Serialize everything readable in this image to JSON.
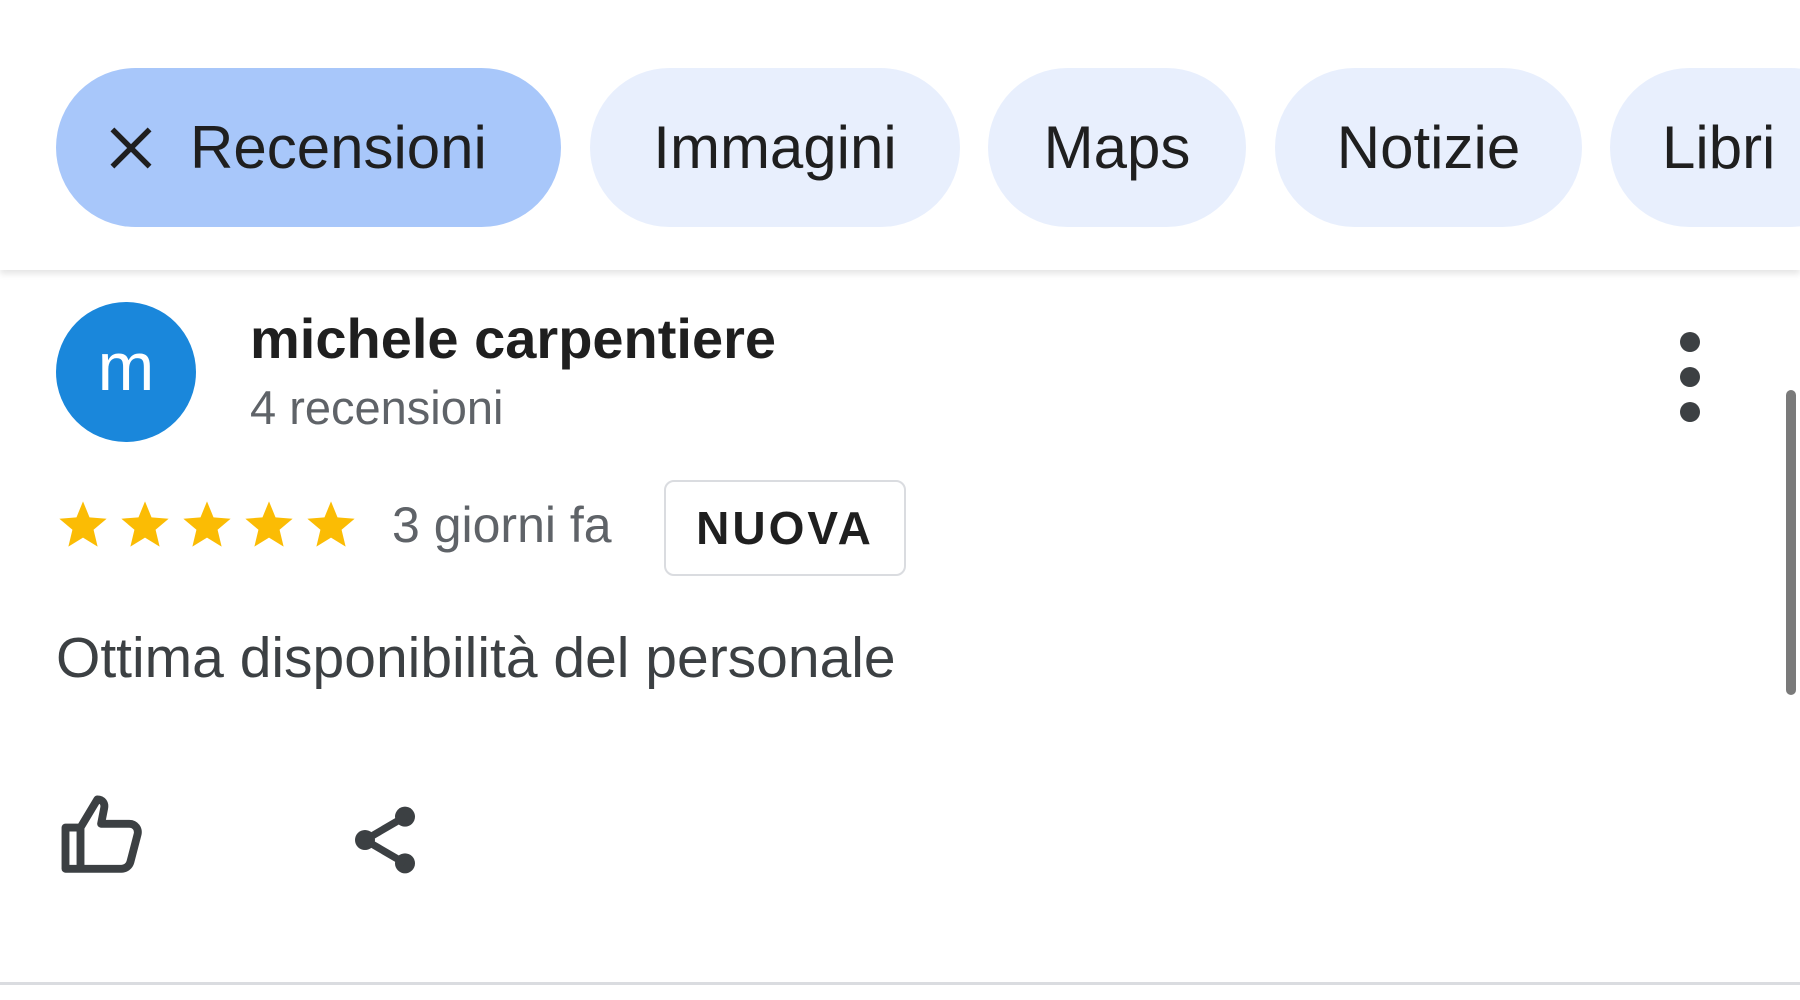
{
  "filters": {
    "chips": [
      {
        "label": "Recensioni",
        "active": true
      },
      {
        "label": "Immagini",
        "active": false
      },
      {
        "label": "Maps",
        "active": false
      },
      {
        "label": "Notizie",
        "active": false
      },
      {
        "label": "Libri",
        "active": false
      }
    ],
    "active_icon": "close-icon"
  },
  "review": {
    "avatar_letter": "m",
    "author_name": "michele carpentiere",
    "author_reviews": "4 recensioni",
    "rating": 5,
    "rating_max": 5,
    "time_ago": "3 giorni fa",
    "badge": "NUOVA",
    "text": "Ottima disponibilità del personale",
    "actions": [
      "thumbs-up-icon",
      "share-icon"
    ],
    "menu_icon": "more-vert-icon"
  },
  "colors": {
    "active_chip": "#a8c7fa",
    "chip": "#e8effd",
    "avatar": "#1a87db",
    "star": "#fbbc04"
  }
}
